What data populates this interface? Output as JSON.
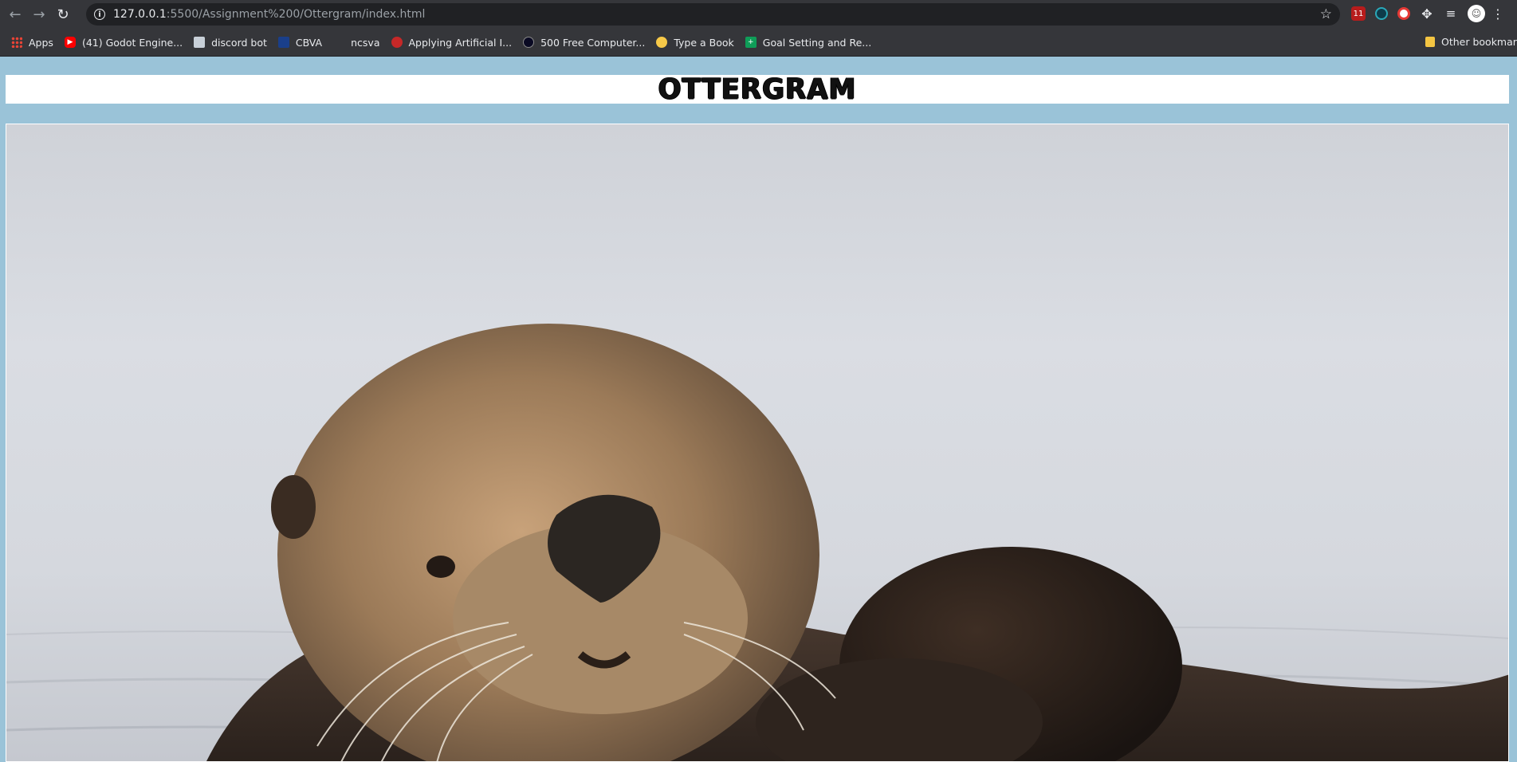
{
  "browser": {
    "url_host": "127.0.0.1",
    "url_rest": ":5500/Assignment%200/Ottergram/index.html",
    "extension_badge": "11"
  },
  "bookmarks": [
    {
      "label": "Apps",
      "icon": "apps-grid-icon"
    },
    {
      "label": "(41) Godot Engine...",
      "icon": "youtube-icon"
    },
    {
      "label": "discord bot",
      "icon": "document-icon"
    },
    {
      "label": "CBVA",
      "icon": "cbva-icon"
    },
    {
      "label": "ncsva",
      "icon": "blank-icon"
    },
    {
      "label": "Applying Artificial I...",
      "icon": "ai-icon"
    },
    {
      "label": "500 Free Computer...",
      "icon": "freecodecamp-icon"
    },
    {
      "label": "Type a Book",
      "icon": "emoji-icon"
    },
    {
      "label": "Goal Setting and Re...",
      "icon": "sheets-icon"
    }
  ],
  "other_bookmarks": "Other bookmarks",
  "page": {
    "logo_text": "OTTERGRAM",
    "background_color": "#9ac3d8"
  },
  "photo": {
    "subject": "sea otter resting on its back in water"
  }
}
